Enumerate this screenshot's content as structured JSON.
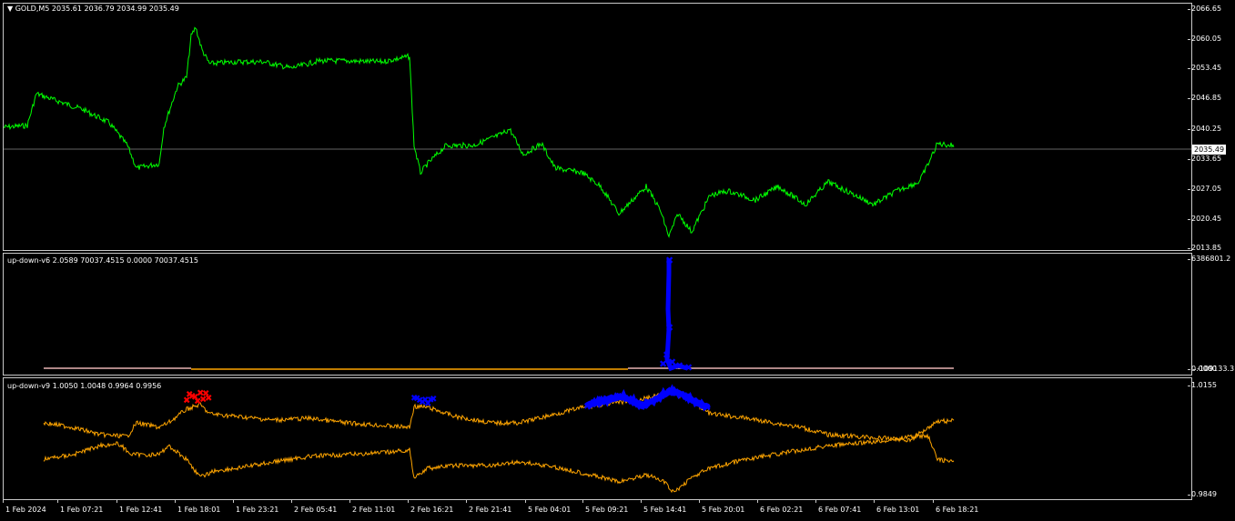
{
  "main": {
    "header": "GOLD,M5  2035.61 2036.79 2034.99 2035.49",
    "current_price": "2035.49",
    "yticks": [
      "2066.65",
      "2060.05",
      "2053.45",
      "2046.85",
      "2040.25",
      "2033.65",
      "2027.05",
      "2020.45",
      "2013.85"
    ],
    "line_color": "#00ff00"
  },
  "ind1": {
    "header": "up-down-v6 2.0589 70037.4515 0.0000 70037.4515",
    "ytick_top": "6386801.2",
    "ytick_bottom": "-109133.3",
    "ytick_bottom2": "0.0000"
  },
  "ind2": {
    "header": "up-down-v9 1.0050 1.0048 0.9964 0.9956",
    "ytick_top": "1.0155",
    "ytick_bottom": "0.9849"
  },
  "xaxis": {
    "labels": [
      "1 Feb 2024",
      "1 Feb 07:21",
      "1 Feb 12:41",
      "1 Feb 18:01",
      "1 Feb 23:21",
      "2 Feb 05:41",
      "2 Feb 11:01",
      "2 Feb 16:21",
      "2 Feb 21:41",
      "5 Feb 04:01",
      "5 Feb 09:21",
      "5 Feb 14:41",
      "5 Feb 20:01",
      "6 Feb 02:21",
      "6 Feb 07:41",
      "6 Feb 13:01",
      "6 Feb 18:21"
    ]
  }
}
